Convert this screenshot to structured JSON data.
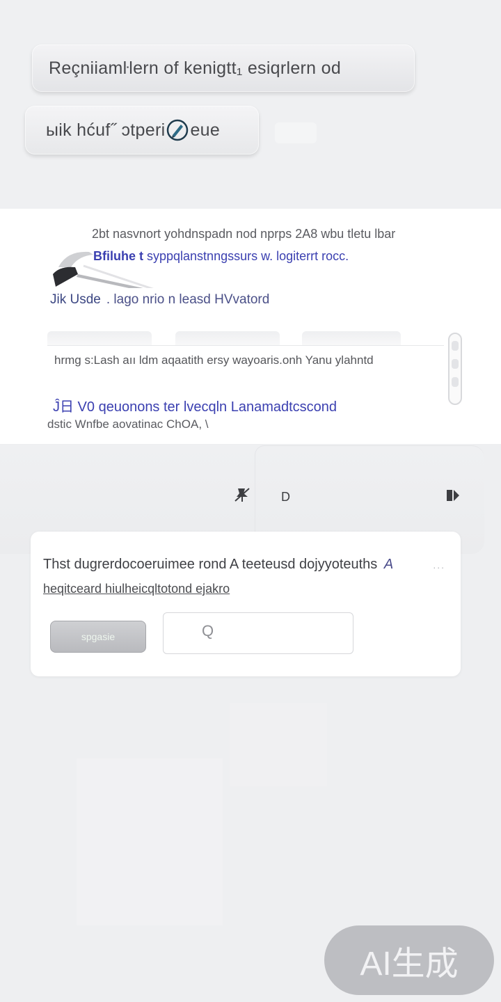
{
  "header": {
    "chip_primary": "Reçniiamŀlern of kenigtt₁ esiqrlern od",
    "chip_secondary_before": "ыik hćuf˝ ɔtperi",
    "chip_secondary_after": "eue"
  },
  "result_card": {
    "line1": "2bt nasvnort yohdnspadn nod nprps 2A8 wbu tletu lbar",
    "line2_bold": "Bfiluhe t",
    "line2_rest": " syppqlanstnngssurs w. logiterrt rocc.",
    "site": "Jik Usde",
    "meta": ". lago nrio n leasd HVvatord",
    "snippet": "hrmg s:Lash aıı ldm aqaatith ersy wayoaris.onh Yanu ylahntd",
    "link": "Ĵ日 V0 qeuonons ter lvecqln Lanamadtcscond",
    "url": "dstic Wnfbe aovatinac ChOA, \\"
  },
  "toolbar": {
    "icon_pin": "pin-icon",
    "label_d": "D",
    "icon_ext": "extension-icon"
  },
  "dialog": {
    "title": "Thst dugrerdocoeruimee rond A teeteusd dojyyoteuths",
    "title_accent": "A",
    "more": "...",
    "link": "heqitceard hiulheicqltotond ejakro",
    "button_label": "spgasie",
    "input_value": "",
    "search_glyph": "Q"
  },
  "watermark": {
    "text": "AI生成"
  },
  "colors": {
    "link": "#3a3fb0",
    "panel": "#ffffff",
    "background": "#eeeff1"
  }
}
